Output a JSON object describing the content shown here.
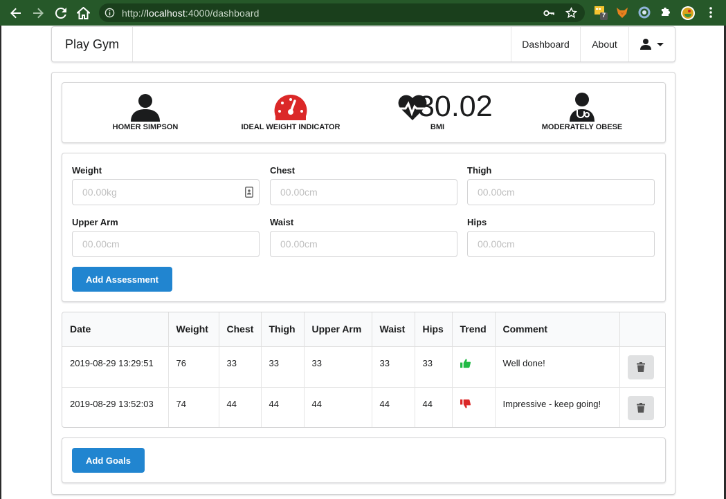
{
  "browser": {
    "url_prefix": "http://",
    "url_host": "localhost",
    "url_path": ":4000/dashboard",
    "extension_badge": "7"
  },
  "nav": {
    "brand": "Play Gym",
    "dashboard": "Dashboard",
    "about": "About"
  },
  "stats": {
    "member_name": "HOMER SIMPSON",
    "weight_indicator_label": "IDEAL WEIGHT INDICATOR",
    "bmi_value": "30.02",
    "bmi_label": "BMI",
    "bmi_category": "MODERATELY OBESE",
    "indicator_color": "#db2828"
  },
  "form": {
    "weight_label": "Weight",
    "weight_placeholder": "00.00kg",
    "chest_label": "Chest",
    "chest_placeholder": "00.00cm",
    "thigh_label": "Thigh",
    "thigh_placeholder": "00.00cm",
    "upper_arm_label": "Upper Arm",
    "upper_arm_placeholder": "00.00cm",
    "waist_label": "Waist",
    "waist_placeholder": "00.00cm",
    "hips_label": "Hips",
    "hips_placeholder": "00.00cm",
    "submit_label": "Add Assessment"
  },
  "table": {
    "headers": [
      "Date",
      "Weight",
      "Chest",
      "Thigh",
      "Upper Arm",
      "Waist",
      "Hips",
      "Trend",
      "Comment",
      ""
    ],
    "rows": [
      {
        "date": "2019-08-29 13:29:51",
        "weight": "76",
        "chest": "33",
        "thigh": "33",
        "upper_arm": "33",
        "waist": "33",
        "hips": "33",
        "trend": "thumbs-up",
        "comment": "Well done!"
      },
      {
        "date": "2019-08-29 13:52:03",
        "weight": "74",
        "chest": "44",
        "thigh": "44",
        "upper_arm": "44",
        "waist": "44",
        "hips": "44",
        "trend": "thumbs-down",
        "comment": "Impressive - keep going!"
      }
    ]
  },
  "goals": {
    "button_label": "Add Goals"
  },
  "colors": {
    "primary": "#2185d0",
    "trend_up": "#21ba45",
    "trend_down": "#db2828",
    "browser_frame": "#265829"
  }
}
